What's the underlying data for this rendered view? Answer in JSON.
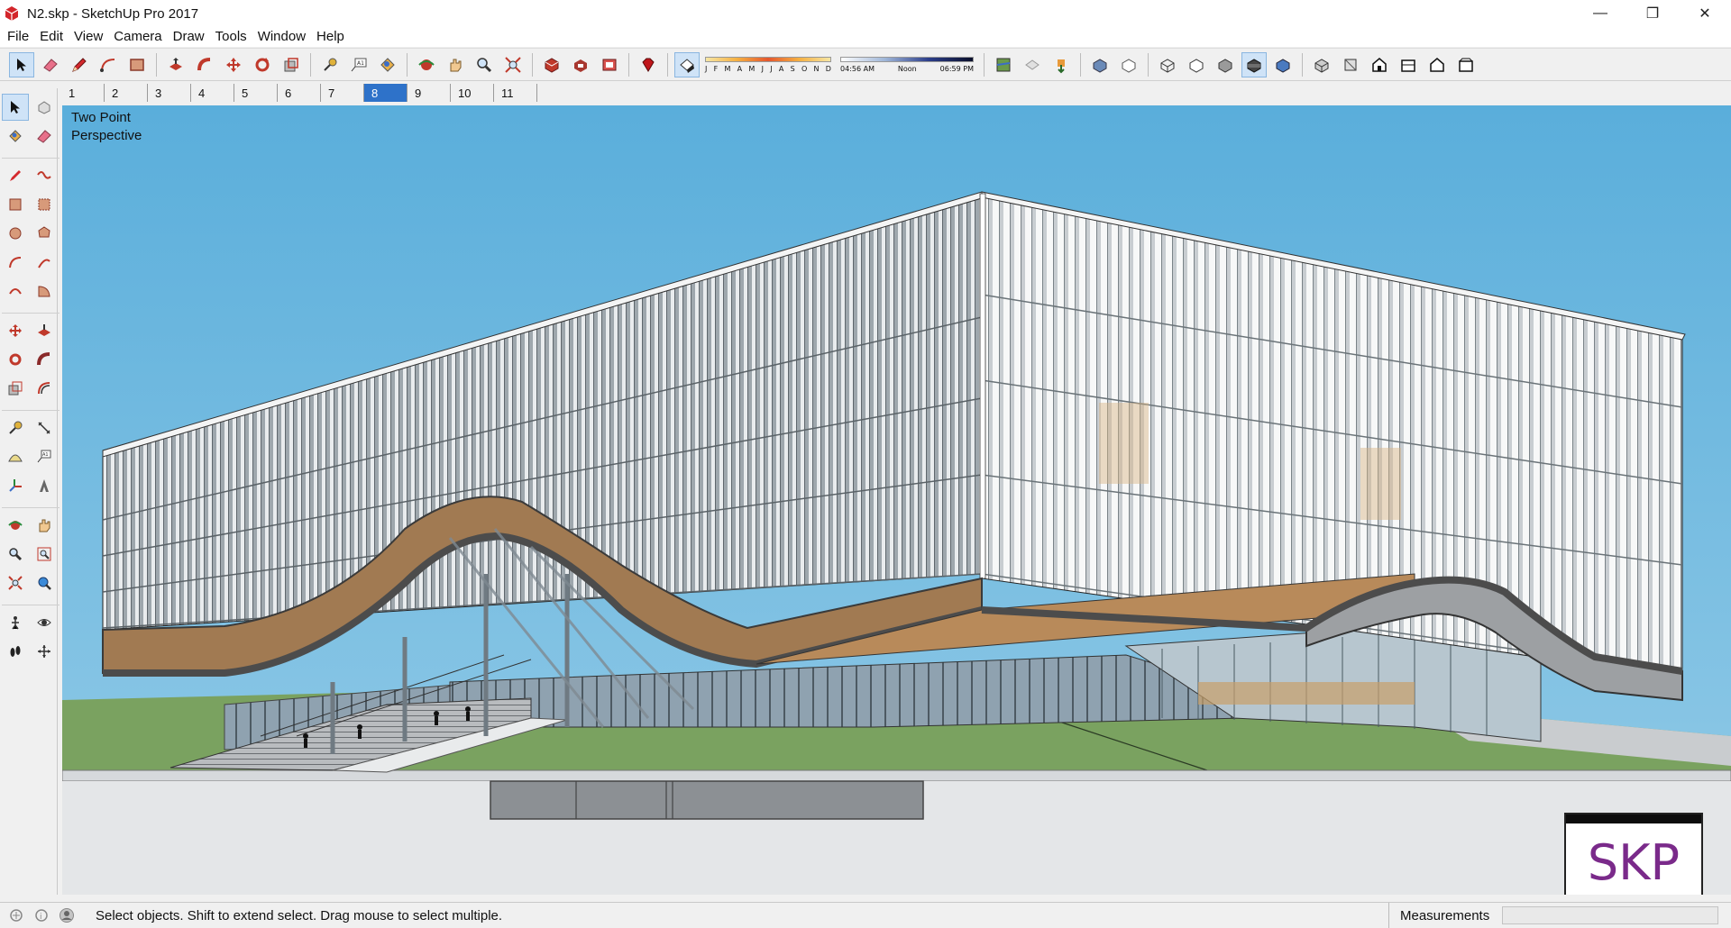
{
  "window": {
    "title": "N2.skp - SketchUp Pro 2017",
    "minimize": "—",
    "maximize": "❐",
    "close": "✕"
  },
  "menu": [
    "File",
    "Edit",
    "View",
    "Camera",
    "Draw",
    "Tools",
    "Window",
    "Help"
  ],
  "shadows": {
    "months": [
      "J",
      "F",
      "M",
      "A",
      "M",
      "J",
      "J",
      "A",
      "S",
      "O",
      "N",
      "D"
    ],
    "time_start": "04:56 AM",
    "time_mid": "Noon",
    "time_end": "06:59 PM"
  },
  "scenes": {
    "tabs": [
      "1",
      "2",
      "3",
      "4",
      "5",
      "6",
      "7",
      "8",
      "9",
      "10",
      "11"
    ],
    "active": "8"
  },
  "viewport": {
    "camera_label": "Two Point\nPerspective",
    "logo_text": "SKP",
    "sky_top": "#5fb0dc",
    "sky_bottom": "#8cc6e6",
    "ground_color": "#7aa260"
  },
  "status": {
    "message": "Select objects. Shift to extend select. Drag mouse to select multiple.",
    "measurements_label": "Measurements",
    "measurements_value": ""
  },
  "icons": {
    "app": "sketchup-logo-icon",
    "toolbar": [
      "select-icon",
      "eraser-icon",
      "pencil-icon",
      "arc-icon",
      "rectangle-icon",
      "push-pull-icon",
      "follow-me-icon",
      "move-icon",
      "rotate-icon",
      "scale-icon",
      "tape-measure-icon",
      "text-icon",
      "paint-bucket-icon",
      "orbit-icon",
      "pan-icon",
      "zoom-icon",
      "zoom-extents-icon",
      "3d-warehouse-icon",
      "extension-warehouse-icon",
      "layout-icon",
      "ruby-icon",
      "shadows-toggle-icon",
      "location-icon",
      "fog-icon",
      "section-icon",
      "xray-icon",
      "back-edges-icon",
      "wireframe-icon",
      "hidden-line-icon",
      "shaded-icon",
      "shaded-textures-icon",
      "monochrome-icon",
      "iso-view-icon",
      "top-view-icon",
      "front-view-icon",
      "right-view-icon",
      "back-view-icon",
      "left-view-icon"
    ]
  }
}
